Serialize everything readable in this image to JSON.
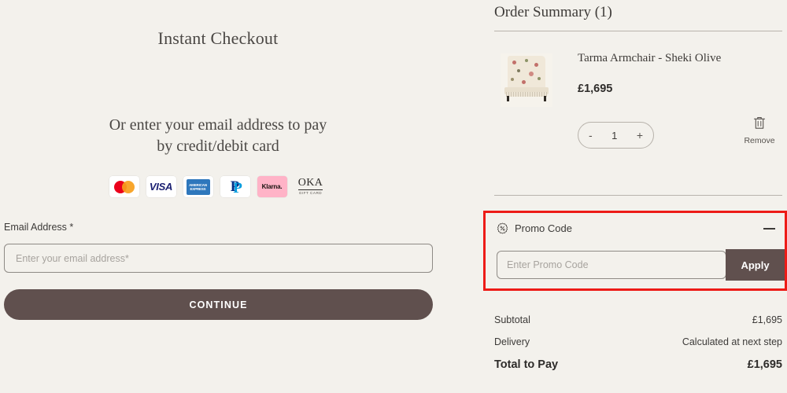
{
  "left": {
    "instant_checkout_title": "Instant Checkout",
    "pay_prompt_line1": "Or enter your email address to pay",
    "pay_prompt_line2": "by credit/debit card",
    "payment_methods": [
      {
        "name": "mastercard-icon",
        "label": "Mastercard"
      },
      {
        "name": "visa-icon",
        "label": "VISA"
      },
      {
        "name": "amex-icon",
        "label": "AMERICAN EXPRESS"
      },
      {
        "name": "paypal-icon",
        "label": "PayPal"
      },
      {
        "name": "klarna-icon",
        "label": "Klarna."
      },
      {
        "name": "oka-gift-card-icon",
        "label": "OKA",
        "sub": "GIFT CARD"
      }
    ],
    "email_label": "Email Address *",
    "email_placeholder": "Enter your email address*",
    "email_value": "",
    "continue_label": "CONTINUE"
  },
  "summary": {
    "title": "Order Summary (1)",
    "item": {
      "name": "Tarma Armchair - Sheki Olive",
      "price": "£1,695",
      "quantity": "1",
      "decrease_label": "-",
      "increase_label": "+",
      "remove_label": "Remove"
    },
    "promo": {
      "header": "Promo Code",
      "placeholder": "Enter Promo Code",
      "value": "",
      "apply_label": "Apply",
      "highlight_color": "#ed1b17"
    },
    "totals": [
      {
        "label": "Subtotal",
        "value": "£1,695"
      },
      {
        "label": "Delivery",
        "value": "Calculated at next step"
      }
    ],
    "grand_total": {
      "label": "Total to Pay",
      "value": "£1,695"
    }
  },
  "theme": {
    "background": "#f3f1ec",
    "button_brown": "#60504e",
    "text": "#3c3a38"
  }
}
